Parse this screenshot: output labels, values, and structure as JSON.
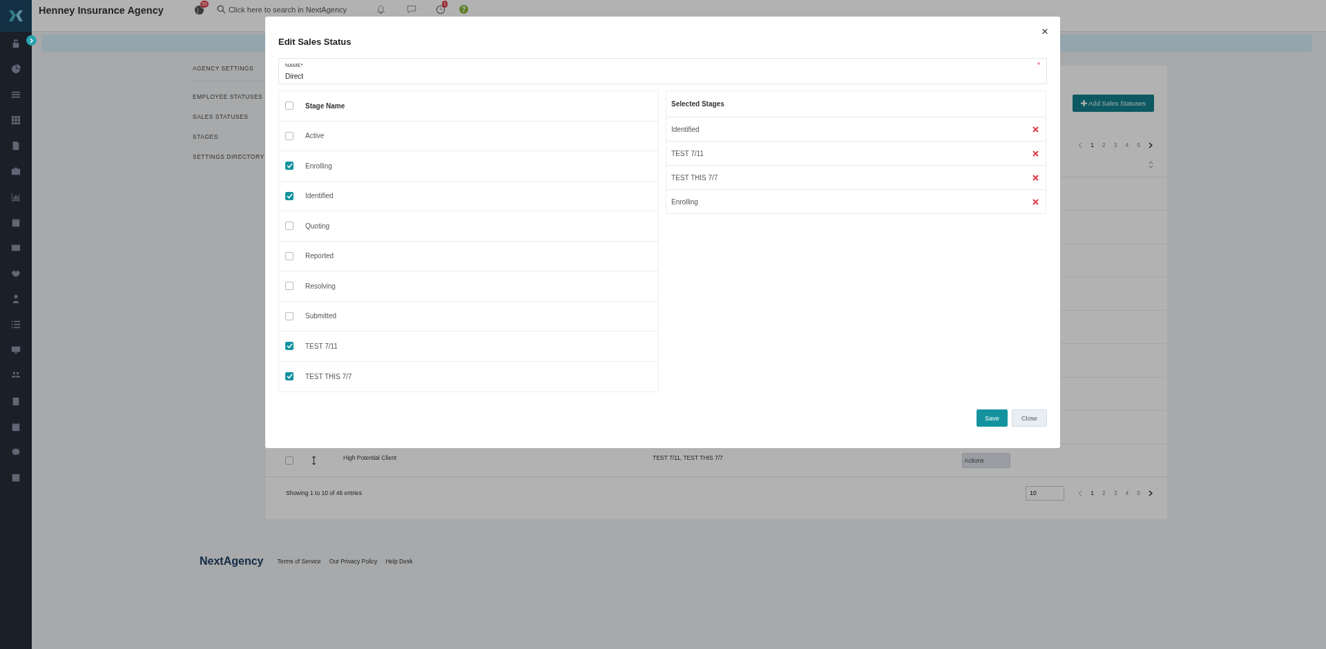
{
  "topbar": {
    "title": "Henney Insurance Agency",
    "notifications_badge": "56",
    "search_placeholder": "Click here to search in NextAgency",
    "alerts_badge": "1",
    "help_glyph": "?"
  },
  "settings_nav": [
    "AGENCY SETTINGS",
    "EMPLOYEE STATUSES",
    "SALES STATUSES",
    "STAGES",
    "SETTINGS DIRECTORY"
  ],
  "add_button": "Add Sales Statuses",
  "pagination_top": [
    {
      "label": "1",
      "selected": true
    },
    {
      "label": "2",
      "selected": false
    },
    {
      "label": "3",
      "selected": false
    },
    {
      "label": "4",
      "selected": false
    },
    {
      "label": "5",
      "selected": false
    }
  ],
  "table": {
    "rows": [
      {
        "checked": false,
        "name": "High Potential Client",
        "stages": "TEST 7/11, TEST THIS 7/7",
        "actions": "Actions"
      }
    ]
  },
  "entries_info": "Showing 1 to 10 of 46 entries",
  "page_size": "10",
  "pagination_bottom": [
    {
      "label": "1",
      "selected": true
    },
    {
      "label": "2",
      "selected": false
    },
    {
      "label": "3",
      "selected": false
    },
    {
      "label": "4",
      "selected": false
    },
    {
      "label": "5",
      "selected": false
    }
  ],
  "footer": {
    "logo": "NextAgency",
    "links": [
      "Terms of Service",
      "Our Privacy Policy",
      "Help Desk"
    ]
  },
  "modal": {
    "title": "Edit Sales Status",
    "close_glyph": "×",
    "name_label": "NAME*",
    "name_value": "Direct",
    "required_mark": "*",
    "stage_header": "Stage Name",
    "select_all": false,
    "stages": [
      {
        "name": "Active",
        "checked": false
      },
      {
        "name": "Enrolling",
        "checked": true
      },
      {
        "name": "Identified",
        "checked": true
      },
      {
        "name": "Quoting",
        "checked": false
      },
      {
        "name": "Reported",
        "checked": false
      },
      {
        "name": "Resolving",
        "checked": false
      },
      {
        "name": "Submitted",
        "checked": false
      },
      {
        "name": "TEST 7/11",
        "checked": true
      },
      {
        "name": "TEST THIS 7/7",
        "checked": true
      }
    ],
    "selected_header": "Selected Stages",
    "selected_stages": [
      "Identified",
      "TEST 7/11",
      "TEST THIS 7/7",
      "Enrolling"
    ],
    "save": "Save",
    "close": "Close"
  }
}
